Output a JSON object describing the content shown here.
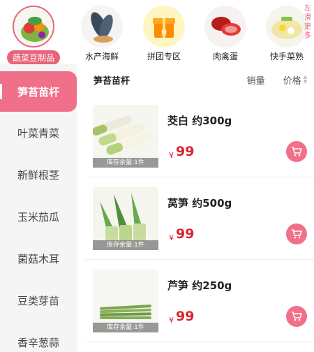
{
  "top_categories": [
    {
      "label": "蔬菜豆制品",
      "active": true
    },
    {
      "label": "水产海鲜",
      "active": false
    },
    {
      "label": "拼团专区",
      "active": false
    },
    {
      "label": "肉禽蛋",
      "active": false
    },
    {
      "label": "快手菜熟",
      "active": false
    }
  ],
  "swipe_hint": "左滑更多",
  "sidebar": {
    "items": [
      {
        "label": "笋苔苗杆",
        "active": true
      },
      {
        "label": "叶菜青菜",
        "active": false
      },
      {
        "label": "新鲜根茎",
        "active": false
      },
      {
        "label": "玉米茄瓜",
        "active": false
      },
      {
        "label": "菌菇木耳",
        "active": false
      },
      {
        "label": "豆类芽苗",
        "active": false
      },
      {
        "label": "香辛葱蒜",
        "active": false
      }
    ]
  },
  "sort_bar": {
    "current": "笋苔苗杆",
    "sales": "销量",
    "price": "价格"
  },
  "products": [
    {
      "name": "茭白 约300g",
      "currency": "¥",
      "price": "99",
      "stock": "库存余量:1件"
    },
    {
      "name": "莴笋 约500g",
      "currency": "¥",
      "price": "99",
      "stock": "库存余量:1件"
    },
    {
      "name": "芦笋 约250g",
      "currency": "¥",
      "price": "99",
      "stock": "库存余量:1件"
    }
  ],
  "colors": {
    "accent": "#f0708a",
    "price": "#d9262e"
  }
}
